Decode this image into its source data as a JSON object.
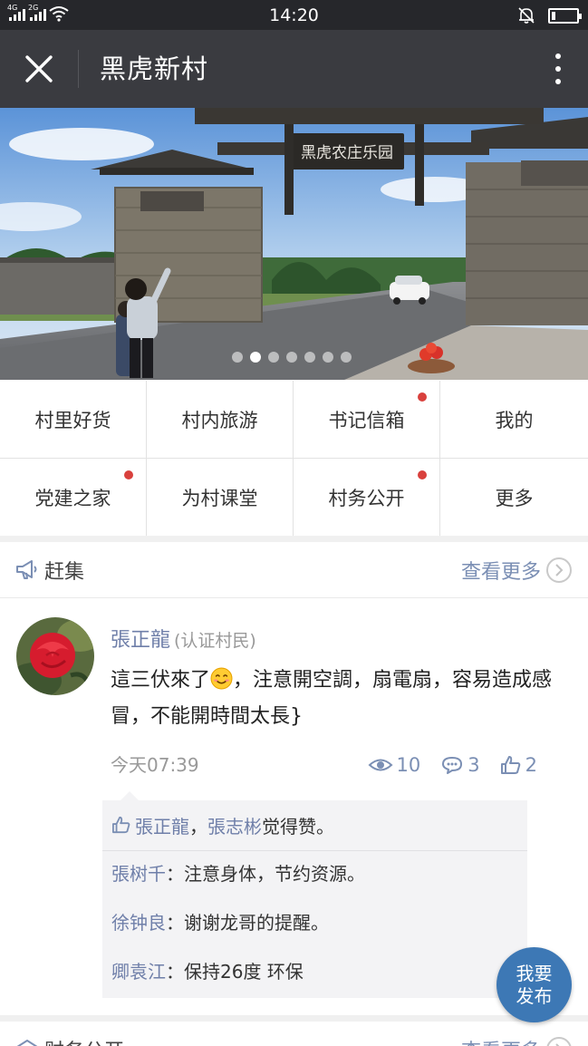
{
  "status_bar": {
    "network1": "4G",
    "network2": "2G",
    "time": "14:20",
    "battery_level": 0.15
  },
  "navbar": {
    "title": "黑虎新村"
  },
  "banner": {
    "gate_sign": "黑虎农庄乐园",
    "slide_count": 7,
    "active_slide": 2
  },
  "grid": {
    "items": [
      {
        "label": "村里好货",
        "badge": false
      },
      {
        "label": "村内旅游",
        "badge": false
      },
      {
        "label": "书记信箱",
        "badge": true
      },
      {
        "label": "我的",
        "badge": false
      },
      {
        "label": "党建之家",
        "badge": true
      },
      {
        "label": "为村课堂",
        "badge": false
      },
      {
        "label": "村务公开",
        "badge": true
      },
      {
        "label": "更多",
        "badge": false
      }
    ]
  },
  "market_section": {
    "title": "赶集",
    "more": "查看更多"
  },
  "post": {
    "author": "張正龍",
    "author_badge": "(认证村民)",
    "text_before_emoji": "這三伏來了",
    "text_after_emoji": "，注意開空調，扇電扇，容易造成感冒，不能開時間太長}",
    "time": "今天07:39",
    "views": "10",
    "comments": "3",
    "likes": "2",
    "liked_by": [
      "張正龍",
      "張志彬"
    ],
    "liked_separator": "，",
    "liked_suffix": " 觉得赞。",
    "comment_list": [
      {
        "name": "張树千",
        "sep": "：",
        "text": "注意身体，节约资源。"
      },
      {
        "name": "徐钟良",
        "sep": "：",
        "text": "谢谢龙哥的提醒。"
      },
      {
        "name": "卿袁江",
        "sep": "：",
        "text": "保持26度 环保"
      }
    ]
  },
  "affairs_section": {
    "title": "财务公开",
    "more": "查看更多"
  },
  "fab": {
    "line1": "我要",
    "line2": "发布"
  },
  "colors": {
    "navbar": "#3a3b40",
    "statusbar": "#26272b",
    "link": "#6f7fa9",
    "badge_dot": "#d9413d",
    "fab": "#3d78b5"
  }
}
